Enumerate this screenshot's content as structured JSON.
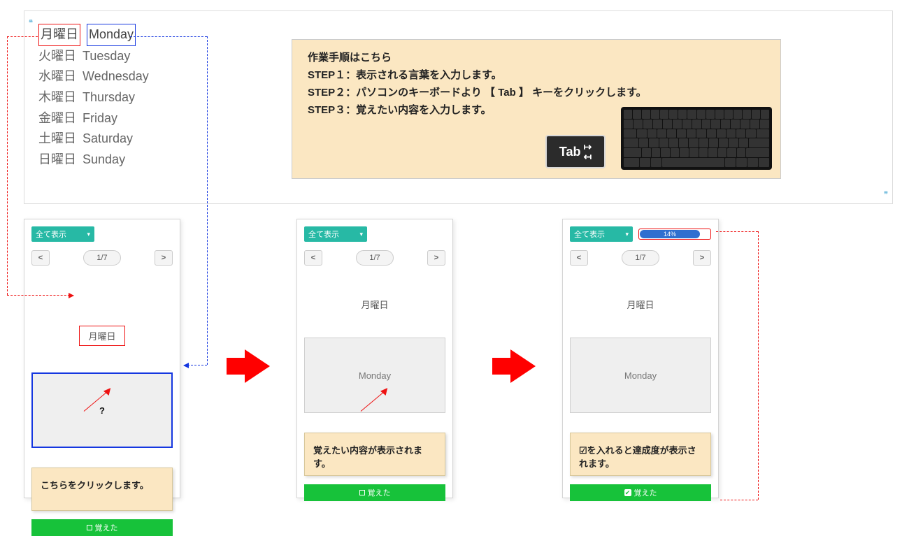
{
  "wordlist": [
    {
      "jp": "月曜日",
      "en": "Monday"
    },
    {
      "jp": "火曜日",
      "en": "Tuesday"
    },
    {
      "jp": "水曜日",
      "en": "Wednesday"
    },
    {
      "jp": "木曜日",
      "en": "Thursday"
    },
    {
      "jp": "金曜日",
      "en": "Friday"
    },
    {
      "jp": "土曜日",
      "en": "Saturday"
    },
    {
      "jp": "日曜日",
      "en": "Sunday"
    }
  ],
  "instructions": {
    "title": "作業手順はこちら",
    "step1": "STEP１：表示される言葉を入力します。",
    "step2": "STEP２：パソコンのキーボードより 【 Tab 】 キーをクリックします。",
    "step3": "STEP３：覚えたい内容を入力します。",
    "tab_label": "Tab"
  },
  "dropdown_label": "全て表示",
  "pager": "1/7",
  "nav_prev": "<",
  "nav_next": ">",
  "prompt_word": "月曜日",
  "card1": {
    "answer": "?",
    "callout": "こちらをクリックします。",
    "learned": "覚えた"
  },
  "card2": {
    "answer": "Monday",
    "callout": "覚えたい内容が表示されます。",
    "learned": "覚えた"
  },
  "card3": {
    "progress": "14%",
    "answer": "Monday",
    "callout": "☑を入れると達成度が表示されます。",
    "learned": "覚えた"
  }
}
